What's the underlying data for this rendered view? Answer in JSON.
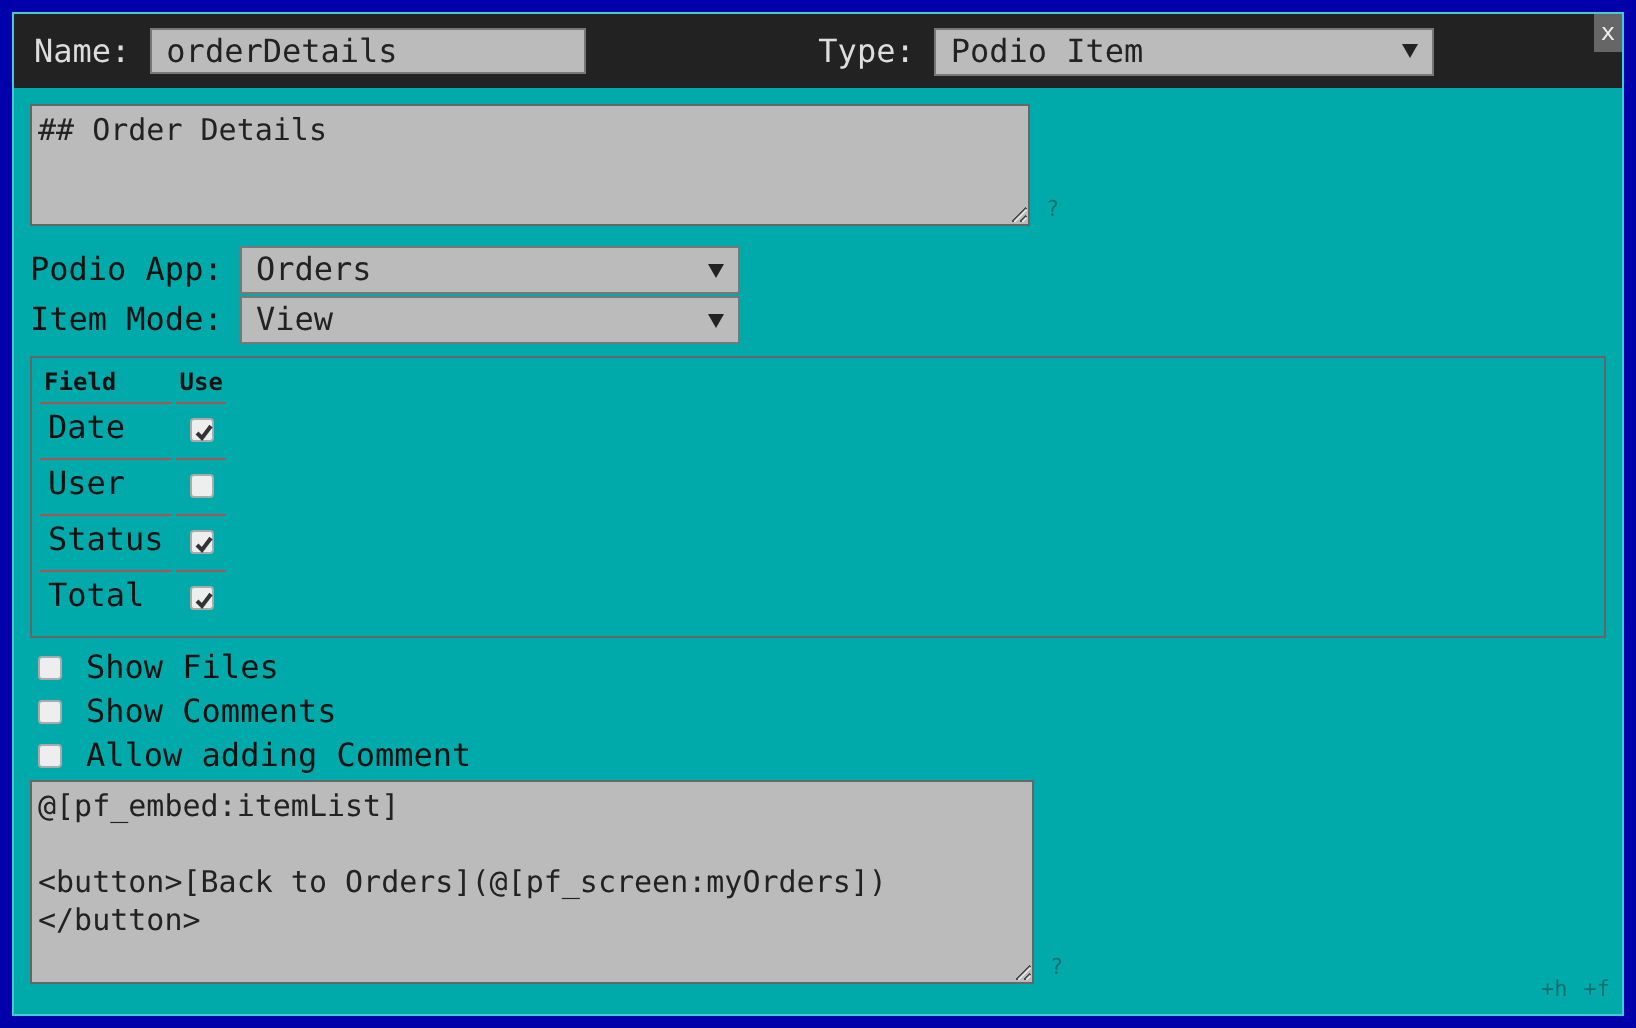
{
  "header": {
    "name_label": "Name:",
    "name_value": "orderDetails",
    "type_label": "Type:",
    "type_value": "Podio Item",
    "close": "x"
  },
  "description": {
    "value": "## Order Details",
    "help": "?"
  },
  "podio_app": {
    "label": "Podio App:",
    "value": "Orders"
  },
  "item_mode": {
    "label": "Item Mode:",
    "value": "View"
  },
  "fields_table": {
    "columns": [
      "Field",
      "Use"
    ],
    "rows": [
      {
        "field": "Date",
        "checked": true
      },
      {
        "field": "User",
        "checked": false
      },
      {
        "field": "Status",
        "checked": true
      },
      {
        "field": "Total",
        "checked": true
      }
    ]
  },
  "options": [
    {
      "label": "Show Files",
      "checked": false
    },
    {
      "label": "Show Comments",
      "checked": false
    },
    {
      "label": "Allow adding Comment",
      "checked": false
    }
  ],
  "template": {
    "value": "@[pf_embed:itemList]\n\n<button>[Back to Orders](@[pf_screen:myOrders])\n</button>",
    "help": "?"
  },
  "footer": [
    "+h",
    "+f"
  ]
}
